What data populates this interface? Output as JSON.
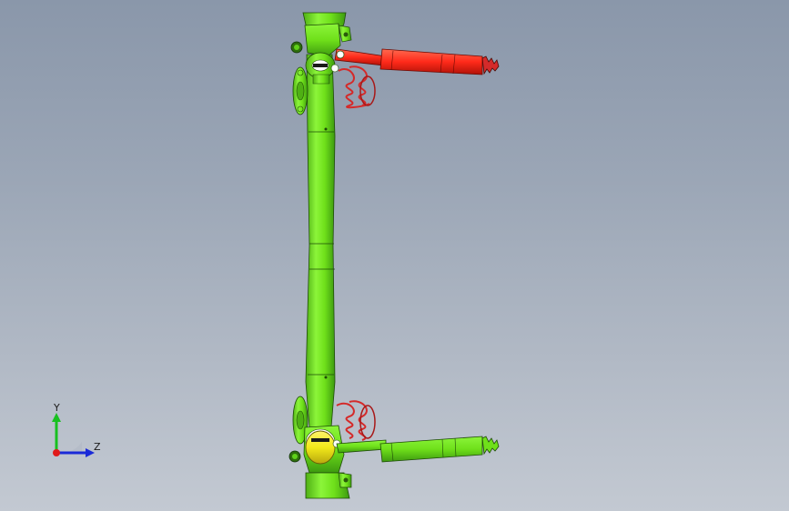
{
  "viewport": {
    "background_top": "#8a97aa",
    "background_bottom": "#c3c9d2"
  },
  "model": {
    "parts": [
      {
        "name": "axle-beam",
        "color": "#6fe01a"
      },
      {
        "name": "upper-shock-absorber",
        "color": "#ff2a1a"
      },
      {
        "name": "lower-shock-absorber",
        "color": "#6fe01a"
      },
      {
        "name": "coil-spring",
        "color": "#d42a2a"
      },
      {
        "name": "selected-bushing",
        "color": "#f2e91a"
      }
    ]
  },
  "triad": {
    "y_label": "Y",
    "z_label": "Z",
    "y_color": "#18c020",
    "z_color": "#1a2ad8",
    "x_color": "#e01a1a"
  }
}
